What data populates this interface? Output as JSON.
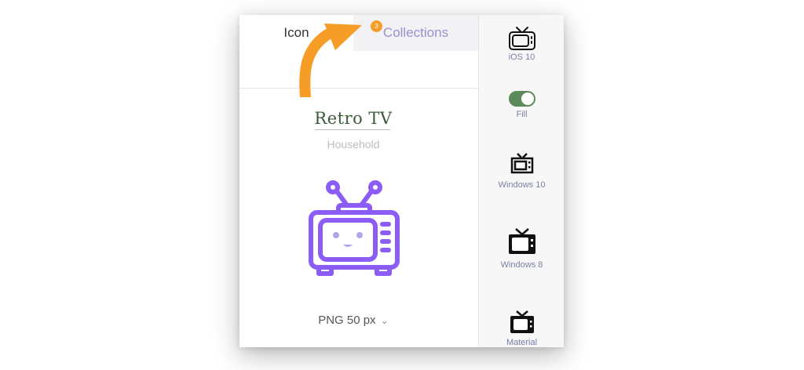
{
  "tabs": {
    "icon": "Icon",
    "collections": "Collections",
    "collections_badge": "3"
  },
  "icon": {
    "title": "Retro TV",
    "category": "Household",
    "download": "PNG 50 px"
  },
  "platforms": [
    {
      "label": "iOS 10",
      "icon": "ios-tv-icon"
    },
    {
      "label": "Fill",
      "icon": "toggle"
    },
    {
      "label": "Windows 10",
      "icon": "windows10-tv-icon"
    },
    {
      "label": "Windows 8",
      "icon": "windows8-tv-icon"
    },
    {
      "label": "Material",
      "icon": "material-tv-icon"
    }
  ],
  "colors": {
    "accent": "#8b5cf6",
    "arrow": "#f59d26",
    "toggle": "#5b8a5b",
    "title": "#3a5a3a"
  },
  "fill_toggle_on": true
}
